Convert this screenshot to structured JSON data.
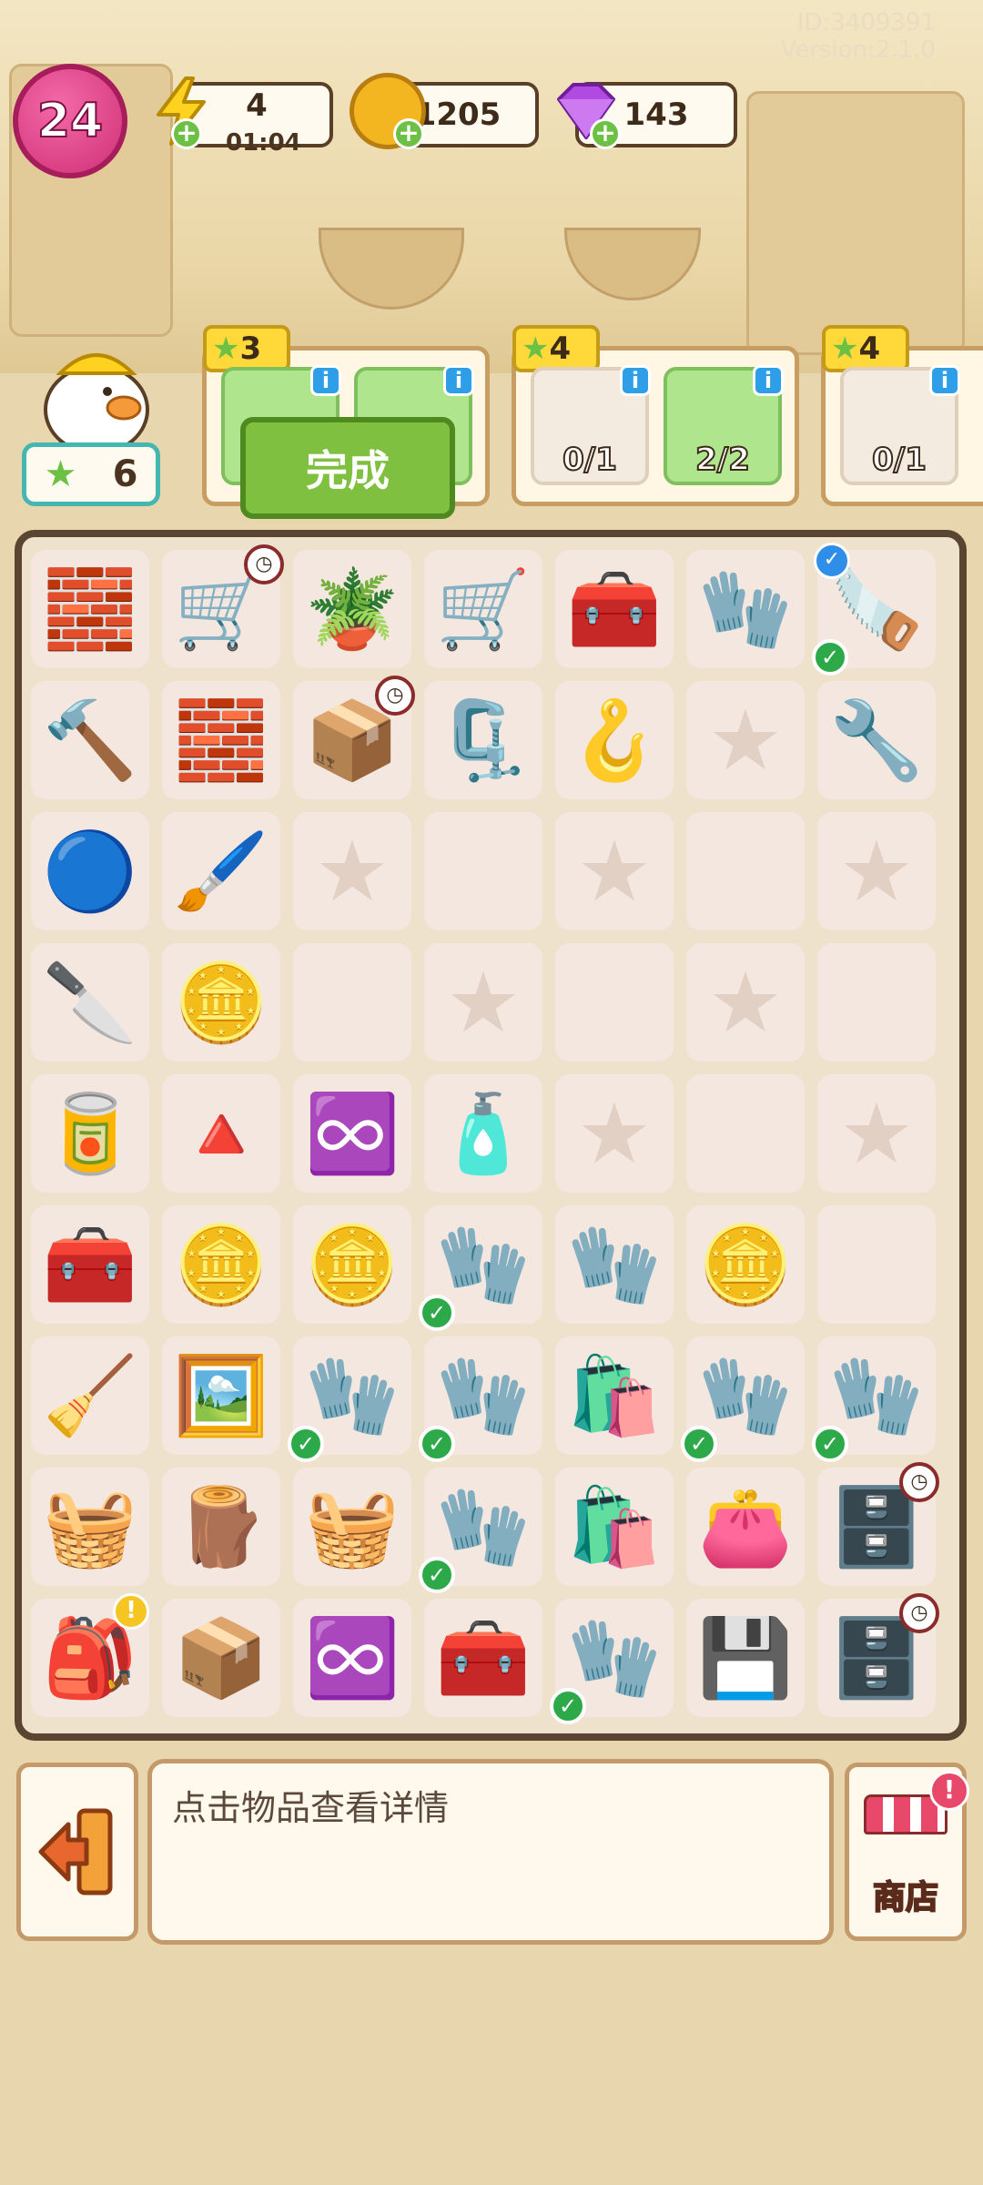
{
  "header": {
    "meta_id": "ID:3409391",
    "meta_version": "Version:2.1.0",
    "level": "24",
    "energy": {
      "value": "4",
      "timer": "01:04",
      "icon": "lightning-icon"
    },
    "coins": {
      "value": "1205",
      "icon": "coin-icon"
    },
    "gems": {
      "value": "143",
      "icon": "gem-icon"
    }
  },
  "helper": {
    "stars": "6"
  },
  "orders": [
    {
      "reward": "3",
      "slots": [
        {
          "item": "saw-icon",
          "count": ""
        },
        {
          "item": "gloves-icon",
          "count": ""
        }
      ],
      "done_label": "完成"
    },
    {
      "reward": "4",
      "slots": [
        {
          "item": "saw-icon",
          "count": "0/1"
        },
        {
          "item": "gloves-icon",
          "count": "2/2"
        }
      ]
    },
    {
      "reward": "4",
      "slots": [
        {
          "item": "saw-icon",
          "count": "0/1"
        }
      ]
    }
  ],
  "board": {
    "rows": [
      [
        "bricks-pallet",
        "wheelbarrow",
        "plant-bucket",
        "shopping-cart",
        "toolbox-green",
        "gloves",
        "hacksaw"
      ],
      [
        "hammer",
        "bricks",
        "cardboard-box",
        "clamp",
        "crowbar",
        "empty-star",
        "pliers"
      ],
      [
        "bonus-10",
        "paint-roller",
        "empty-star",
        "empty",
        "empty-star",
        "empty",
        "empty-star"
      ],
      [
        "utility-knife",
        "coin-stack",
        "empty",
        "empty-star",
        "empty",
        "empty-star",
        "empty"
      ],
      [
        "paint-can",
        "trowel",
        "infinity-hex-green",
        "spray-can",
        "empty-star",
        "empty",
        "empty-star"
      ],
      [
        "green-box",
        "coin-pile",
        "coins",
        "work-gloves",
        "glove",
        "coin",
        "empty"
      ],
      [
        "dustpan",
        "frame",
        "work-gloves",
        "work-gloves",
        "sack",
        "work-gloves",
        "work-gloves"
      ],
      [
        "basket",
        "wood-chunk",
        "basket-small",
        "work-gloves",
        "sacks",
        "wallet",
        "cabinet"
      ],
      [
        "backpack",
        "cardboard-box-small",
        "infinity-hex-pink",
        "toolbox-green",
        "glove",
        "circuit-board",
        "drawers"
      ]
    ]
  },
  "bottom": {
    "hint": "点击物品查看详情",
    "shop_label": "商店"
  }
}
